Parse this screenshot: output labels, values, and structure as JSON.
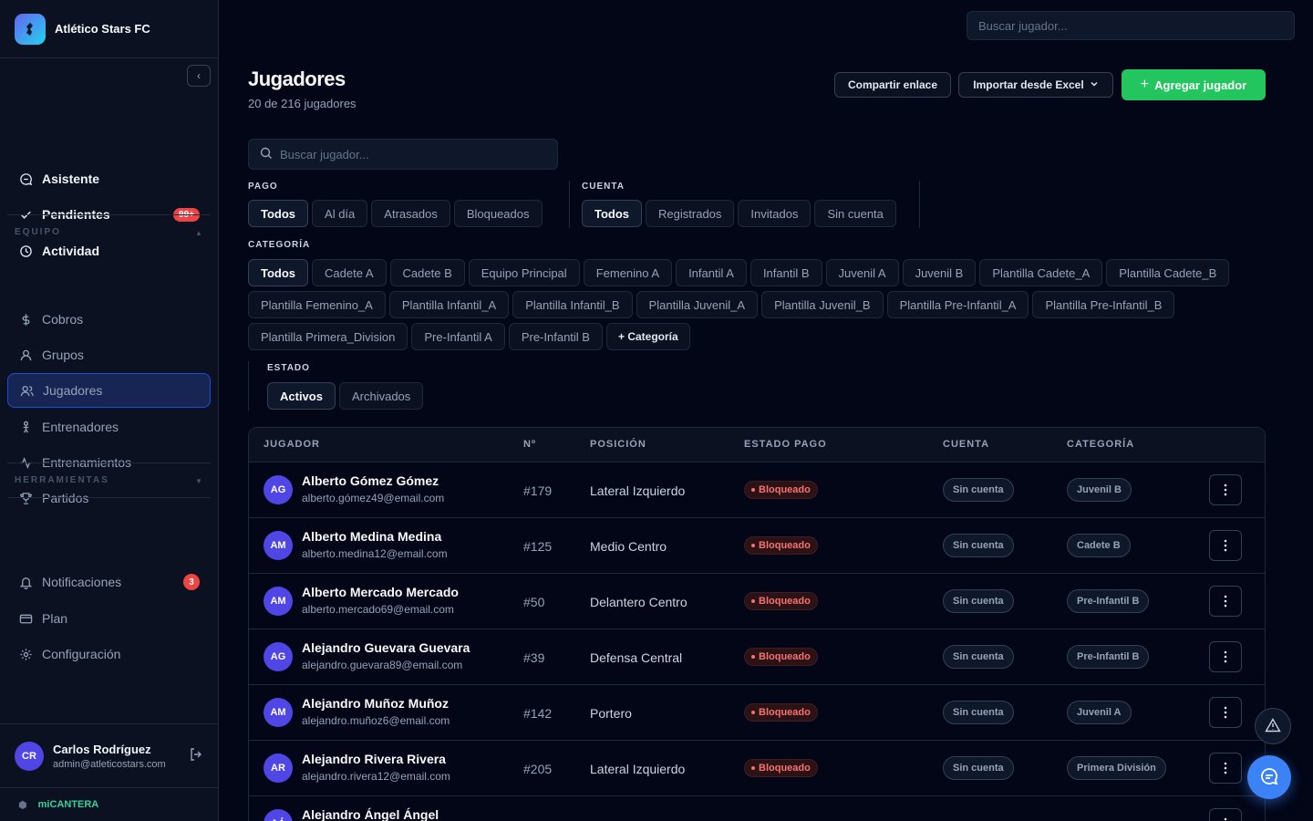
{
  "brand": {
    "name": "Atlético Stars FC"
  },
  "sidebar": {
    "top_items": [
      {
        "label": "Asistente",
        "icon": "chat-icon"
      },
      {
        "label": "Pendientes",
        "icon": "check-icon",
        "badge": "99+"
      },
      {
        "label": "Actividad",
        "icon": "clock-icon"
      }
    ],
    "section_equipo": "EQUIPO",
    "equipo_items": [
      {
        "label": "Cobros",
        "icon": "dollar-icon"
      },
      {
        "label": "Grupos",
        "icon": "user-icon"
      },
      {
        "label": "Jugadores",
        "icon": "users-icon",
        "active": true
      },
      {
        "label": "Entrenadores",
        "icon": "coach-icon"
      },
      {
        "label": "Entrenamientos",
        "icon": "activity-icon"
      },
      {
        "label": "Partidos",
        "icon": "trophy-icon"
      }
    ],
    "section_herramientas": "HERRAMIENTAS",
    "herramientas_items": [
      {
        "label": "Notificaciones",
        "icon": "bell-icon",
        "badge": "3"
      },
      {
        "label": "Plan",
        "icon": "card-icon"
      },
      {
        "label": "Configuración",
        "icon": "gear-icon"
      }
    ]
  },
  "user": {
    "initials": "CR",
    "name": "Carlos Rodríguez",
    "email": "admin@atleticostars.com"
  },
  "footer": {
    "brand": "miCANTERA"
  },
  "top_search": {
    "placeholder": "Buscar jugador..."
  },
  "header": {
    "title": "Jugadores",
    "subtitle": "20 de 216 jugadores",
    "share_label": "Compartir enlace",
    "import_label": "Importar desde Excel",
    "add_label": "Agregar jugador"
  },
  "search": {
    "placeholder": "Buscar jugador..."
  },
  "filters": {
    "pago": {
      "label": "PAGO",
      "options": [
        "Todos",
        "Al día",
        "Atrasados",
        "Bloqueados"
      ],
      "selected": "Todos"
    },
    "cuenta": {
      "label": "CUENTA",
      "options": [
        "Todos",
        "Registrados",
        "Invitados",
        "Sin cuenta"
      ],
      "selected": "Todos"
    },
    "categoria": {
      "label": "CATEGORÍA",
      "options": [
        "Todos",
        "Cadete A",
        "Cadete B",
        "Equipo Principal",
        "Femenino A",
        "Infantil A",
        "Infantil B",
        "Juvenil A",
        "Juvenil B",
        "Plantilla Cadete_A",
        "Plantilla Cadete_B",
        "Plantilla Femenino_A",
        "Plantilla Infantil_A",
        "Plantilla Infantil_B",
        "Plantilla Juvenil_A",
        "Plantilla Juvenil_B",
        "Plantilla Pre-Infantil_A",
        "Plantilla Pre-Infantil_B",
        "Plantilla Primera_Division",
        "Pre-Infantil A",
        "Pre-Infantil B"
      ],
      "selected": "Todos",
      "add_label": "+ Categoría"
    },
    "estado": {
      "label": "ESTADO",
      "options": [
        "Activos",
        "Archivados"
      ],
      "selected": "Activos"
    }
  },
  "table": {
    "columns": [
      "JUGADOR",
      "Nº",
      "POSICIÓN",
      "ESTADO PAGO",
      "CUENTA",
      "CATEGORÍA"
    ],
    "rows": [
      {
        "initials": "AG",
        "name": "Alberto Gómez Gómez",
        "email": "alberto.gómez49@email.com",
        "number": "#179",
        "position": "Lateral Izquierdo",
        "payment": "Bloqueado",
        "account": "Sin cuenta",
        "category": "Juvenil B"
      },
      {
        "initials": "AM",
        "name": "Alberto Medina Medina",
        "email": "alberto.medina12@email.com",
        "number": "#125",
        "position": "Medio Centro",
        "payment": "Bloqueado",
        "account": "Sin cuenta",
        "category": "Cadete B"
      },
      {
        "initials": "AM",
        "name": "Alberto Mercado Mercado",
        "email": "alberto.mercado69@email.com",
        "number": "#50",
        "position": "Delantero Centro",
        "payment": "Bloqueado",
        "account": "Sin cuenta",
        "category": "Pre-Infantil B"
      },
      {
        "initials": "AG",
        "name": "Alejandro Guevara Guevara",
        "email": "alejandro.guevara89@email.com",
        "number": "#39",
        "position": "Defensa Central",
        "payment": "Bloqueado",
        "account": "Sin cuenta",
        "category": "Pre-Infantil B"
      },
      {
        "initials": "AM",
        "name": "Alejandro Muñoz Muñoz",
        "email": "alejandro.muñoz6@email.com",
        "number": "#142",
        "position": "Portero",
        "payment": "Bloqueado",
        "account": "Sin cuenta",
        "category": "Juvenil A"
      },
      {
        "initials": "AR",
        "name": "Alejandro Rivera Rivera",
        "email": "alejandro.rivera12@email.com",
        "number": "#205",
        "position": "Lateral Izquierdo",
        "payment": "Bloqueado",
        "account": "Sin cuenta",
        "category": "Primera División"
      },
      {
        "initials": "AÁ",
        "name": "Alejandro Ángel Ángel",
        "email": "",
        "number": "",
        "position": "",
        "payment": "",
        "account": "",
        "category": ""
      }
    ]
  },
  "colors": {
    "accent": "#22c55e",
    "active_nav": "#172554",
    "danger": "#ef4444",
    "avatar": "#4f46e5",
    "chat": "#3b82f6"
  }
}
